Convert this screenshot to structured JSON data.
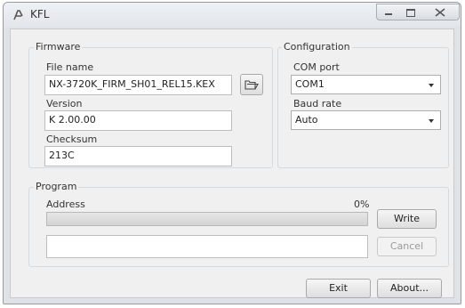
{
  "window": {
    "title": "KFL"
  },
  "firmware": {
    "group_label": "Firmware",
    "file_name_label": "File name",
    "file_name_value": "NX-3720K_FIRM_SH01_REL15.KEX",
    "version_label": "Version",
    "version_value": "K 2.00.00",
    "checksum_label": "Checksum",
    "checksum_value": "213C"
  },
  "configuration": {
    "group_label": "Configuration",
    "com_port_label": "COM port",
    "com_port_value": "COM1",
    "baud_rate_label": "Baud rate",
    "baud_rate_value": "Auto"
  },
  "program": {
    "group_label": "Program",
    "address_label": "Address",
    "progress_percent": "0%",
    "progress_fraction": 0,
    "write_label": "Write",
    "cancel_label": "Cancel"
  },
  "footer": {
    "exit_label": "Exit",
    "about_label": "About..."
  },
  "icons": {
    "app": "kfl-app-icon",
    "open": "open-folder-icon",
    "minimize": "minimize-icon",
    "maximize": "maximize-icon",
    "close": "close-icon"
  }
}
